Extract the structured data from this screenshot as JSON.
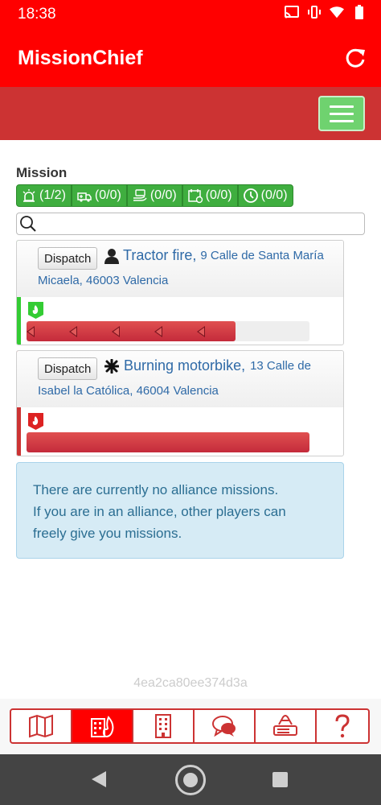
{
  "status_bar": {
    "time": "18:38",
    "icons": [
      "cast-icon",
      "vibrate-icon",
      "wifi-icon",
      "battery-icon"
    ]
  },
  "app": {
    "title": "MissionChief",
    "refresh_icon": "refresh-icon",
    "menu_icon": "hamburger-icon"
  },
  "section": {
    "title": "Mission"
  },
  "filters": [
    {
      "icon": "siren-icon",
      "label": "(1/2)"
    },
    {
      "icon": "ambulance-icon",
      "label": "(0/0)"
    },
    {
      "icon": "police-hand-icon",
      "label": "(0/0)"
    },
    {
      "icon": "calendar-icon",
      "label": "(0/0)"
    },
    {
      "icon": "clock-icon",
      "label": "(0/0)"
    }
  ],
  "search": {
    "placeholder": "",
    "icon": "search-icon"
  },
  "missions": [
    {
      "dispatch_label": "Dispatch",
      "type_icon": "person-icon",
      "name": "Tractor fire,",
      "address_part1": "9 Calle de Santa María",
      "address_part2": "Micaela, 46003 Valencia",
      "badge_icon": "fire-badge-icon",
      "status_color": "#33cc33",
      "progress_fraction": 0.74
    },
    {
      "dispatch_label": "Dispatch",
      "type_icon": "asterisk-icon",
      "name": "Burning motorbike,",
      "address_part1": "13 Calle de",
      "address_part2": "Isabel la Católica, 46004 Valencia",
      "badge_icon": "fire-badge-icon",
      "status_color": "#cc3333",
      "progress_fraction": 1.0
    }
  ],
  "alliance_notice": {
    "line1": "There are currently no alliance missions.",
    "line2": "If you are in an alliance, other players can",
    "line3": "freely give you missions."
  },
  "footer_hash": "4ea2ca80ee374d3a",
  "bottom_tabs": [
    {
      "icon": "map-icon",
      "active": false
    },
    {
      "icon": "building-fire-icon",
      "active": true
    },
    {
      "icon": "building-icon",
      "active": false
    },
    {
      "icon": "chat-icon",
      "active": false
    },
    {
      "icon": "vehicle-list-icon",
      "active": false
    },
    {
      "icon": "help-icon",
      "active": false
    }
  ],
  "colors": {
    "primary": "#ff0000",
    "secondary": "#cc3333",
    "success": "#3fae3f",
    "link": "#2f6aa7"
  }
}
